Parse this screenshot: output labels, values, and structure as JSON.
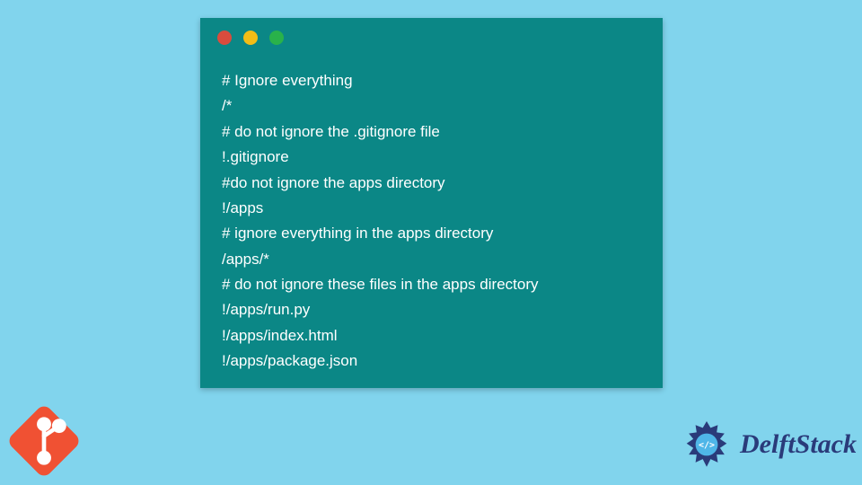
{
  "window": {
    "traffic_lights": {
      "red": "#d94c3d",
      "yellow": "#f2bd16",
      "green": "#29b24a"
    }
  },
  "code": {
    "lines": [
      "# Ignore everything",
      "/*",
      "# do not ignore the .gitignore file",
      "!.gitignore",
      "#do not ignore the apps directory",
      "!/apps",
      "# ignore everything in the apps directory",
      "/apps/*",
      "# do not ignore these files in the apps directory",
      "!/apps/run.py",
      "!/apps/index.html",
      "!/apps/package.json"
    ]
  },
  "branding": {
    "git_logo": "git-icon",
    "delft_label": "DelftStack"
  },
  "colors": {
    "page_bg": "#81d4ed",
    "window_bg": "#0b8786",
    "code_fg": "#ffffff",
    "git_orange": "#f05133",
    "delft_blue": "#2a3b7a"
  }
}
